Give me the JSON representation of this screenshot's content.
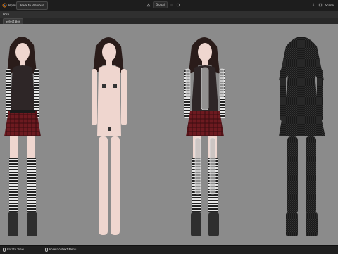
{
  "topbar": {
    "menu_label": "Pipeline",
    "back_button_label": "Back to Previous",
    "view_mode": "Global",
    "scene_label": "Scene"
  },
  "toolbar": {
    "pose_label": "Pose",
    "select_box_label": "Select Box"
  },
  "status": {
    "left_label": "Rotate View",
    "middle_label": "Pose Context Menu"
  },
  "colors": {
    "ui_dark": "#1d1d1d",
    "viewport_bg": "#8b8b8b",
    "skirt_red": "#7a1f24",
    "skin": "#efd6cf",
    "hair": "#2a1c1a"
  },
  "icons": [
    "blender-logo-icon",
    "transform-icon",
    "snap-icon",
    "proportional-icon",
    "scene-icon",
    "pin-icon",
    "mouse-icon"
  ],
  "viewport": {
    "figures": [
      "clothed-figure",
      "nude-figure",
      "rigged-figure",
      "wireframe-figure"
    ]
  }
}
